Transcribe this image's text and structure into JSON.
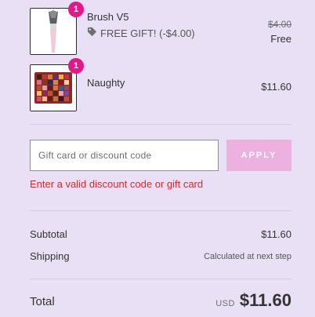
{
  "items": [
    {
      "name": "Brush V5",
      "quantity": "1",
      "discount_text": "FREE GIFT! (-$4.00)",
      "discount_icon": "tag-icon",
      "original_price": "$4.00",
      "price": "Free"
    },
    {
      "name": "Naughty",
      "quantity": "1",
      "price": "$11.60"
    }
  ],
  "discount": {
    "placeholder": "Gift card or discount code",
    "value": "",
    "apply_label": "APPLY",
    "error": "Enter a valid discount code or gift card"
  },
  "summary": {
    "subtotal_label": "Subtotal",
    "subtotal_value": "$11.60",
    "shipping_label": "Shipping",
    "shipping_value": "Calculated at next step",
    "total_label": "Total",
    "currency": "USD",
    "total_value": "$11.60"
  },
  "colors": {
    "background": "#e9e0f6",
    "badge": "#e0198a",
    "apply_button": "#ecb1de",
    "error": "#d52b2b"
  }
}
